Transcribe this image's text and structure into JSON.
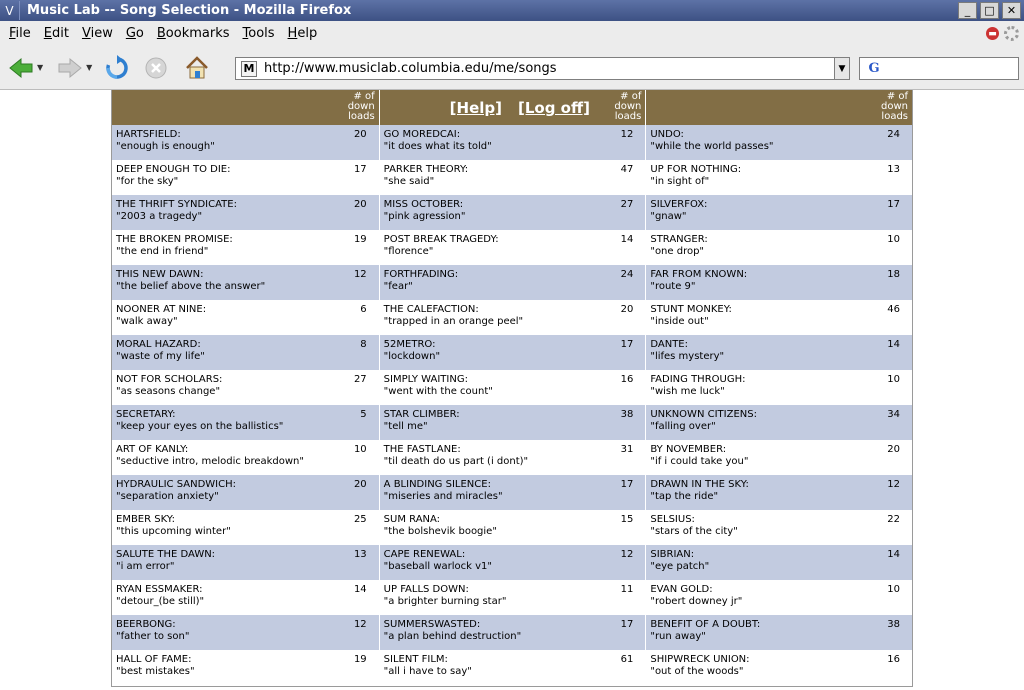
{
  "window": {
    "title": "Music Lab -- Song Selection - Mozilla Firefox",
    "menu_glyph": "V",
    "minimize_glyph": "_",
    "maximize_glyph": "□",
    "close_glyph": "✕"
  },
  "menubar": {
    "items": [
      {
        "key": "F",
        "rest": "ile"
      },
      {
        "key": "E",
        "rest": "dit"
      },
      {
        "key": "V",
        "rest": "iew"
      },
      {
        "key": "G",
        "rest": "o"
      },
      {
        "key": "B",
        "rest": "ookmarks"
      },
      {
        "key": "T",
        "rest": "ools"
      },
      {
        "key": "H",
        "rest": "elp"
      }
    ]
  },
  "toolbar": {
    "url": "http://www.musiclab.columbia.edu/me/songs",
    "favicon_letter": "M",
    "search_engine_letter": "G"
  },
  "icons": {
    "back": "back-arrow-icon",
    "forward": "forward-arrow-icon",
    "reload": "reload-icon",
    "stop": "stop-icon",
    "home": "home-icon",
    "search_engine": "google-icon",
    "throbber": "throbber-icon",
    "stop_red": "stop-red-icon"
  },
  "colors": {
    "header_bg": "#826e45",
    "shade_row": "#c2cbe0",
    "titlebar": "#4a5e94"
  },
  "page": {
    "downloads_label": [
      "# of",
      "down",
      "loads"
    ],
    "help_link": "[Help]",
    "logoff_link": "[Log off]",
    "columns": [
      [
        {
          "band": "HARTSFIELD:",
          "song": "\"enough is enough\"",
          "downloads": 20
        },
        {
          "band": "DEEP ENOUGH TO DIE:",
          "song": "\"for the sky\"",
          "downloads": 17
        },
        {
          "band": "THE THRIFT SYNDICATE:",
          "song": "\"2003 a tragedy\"",
          "downloads": 20
        },
        {
          "band": "THE BROKEN PROMISE:",
          "song": "\"the end in friend\"",
          "downloads": 19
        },
        {
          "band": "THIS NEW DAWN:",
          "song": "\"the belief above the answer\"",
          "downloads": 12
        },
        {
          "band": "NOONER AT NINE:",
          "song": "\"walk away\"",
          "downloads": 6
        },
        {
          "band": "MORAL HAZARD:",
          "song": "\"waste of my life\"",
          "downloads": 8
        },
        {
          "band": "NOT FOR SCHOLARS:",
          "song": "\"as seasons change\"",
          "downloads": 27
        },
        {
          "band": "SECRETARY:",
          "song": "\"keep your eyes on the ballistics\"",
          "downloads": 5
        },
        {
          "band": "ART OF KANLY:",
          "song": "\"seductive intro, melodic breakdown\"",
          "downloads": 10
        },
        {
          "band": "HYDRAULIC SANDWICH:",
          "song": "\"separation anxiety\"",
          "downloads": 20
        },
        {
          "band": "EMBER SKY:",
          "song": "\"this upcoming winter\"",
          "downloads": 25
        },
        {
          "band": "SALUTE THE DAWN:",
          "song": "\"i am error\"",
          "downloads": 13
        },
        {
          "band": "RYAN ESSMAKER:",
          "song": "\"detour_(be still)\"",
          "downloads": 14
        },
        {
          "band": "BEERBONG:",
          "song": "\"father to son\"",
          "downloads": 12
        },
        {
          "band": "HALL OF FAME:",
          "song": "\"best mistakes\"",
          "downloads": 19
        }
      ],
      [
        {
          "band": "GO MOREDCAI:",
          "song": "\"it does what its told\"",
          "downloads": 12
        },
        {
          "band": "PARKER THEORY:",
          "song": "\"she said\"",
          "downloads": 47
        },
        {
          "band": "MISS OCTOBER:",
          "song": "\"pink agression\"",
          "downloads": 27
        },
        {
          "band": "POST BREAK TRAGEDY:",
          "song": "\"florence\"",
          "downloads": 14
        },
        {
          "band": "FORTHFADING:",
          "song": "\"fear\"",
          "downloads": 24
        },
        {
          "band": "THE CALEFACTION:",
          "song": "\"trapped in an orange peel\"",
          "downloads": 20
        },
        {
          "band": "52METRO:",
          "song": "\"lockdown\"",
          "downloads": 17
        },
        {
          "band": "SIMPLY WAITING:",
          "song": "\"went with the count\"",
          "downloads": 16
        },
        {
          "band": "STAR CLIMBER:",
          "song": "\"tell me\"",
          "downloads": 38
        },
        {
          "band": "THE FASTLANE:",
          "song": "\"til death do us part (i dont)\"",
          "downloads": 31
        },
        {
          "band": "A BLINDING SILENCE:",
          "song": "\"miseries and miracles\"",
          "downloads": 17
        },
        {
          "band": "SUM RANA:",
          "song": "\"the bolshevik boogie\"",
          "downloads": 15
        },
        {
          "band": "CAPE RENEWAL:",
          "song": "\"baseball warlock v1\"",
          "downloads": 12
        },
        {
          "band": "UP FALLS DOWN:",
          "song": "\"a brighter burning star\"",
          "downloads": 11
        },
        {
          "band": "SUMMERSWASTED:",
          "song": "\"a plan behind destruction\"",
          "downloads": 17
        },
        {
          "band": "SILENT FILM:",
          "song": "\"all i have to say\"",
          "downloads": 61
        }
      ],
      [
        {
          "band": "UNDO:",
          "song": "\"while the world passes\"",
          "downloads": 24
        },
        {
          "band": "UP FOR NOTHING:",
          "song": "\"in sight of\"",
          "downloads": 13
        },
        {
          "band": "SILVERFOX:",
          "song": "\"gnaw\"",
          "downloads": 17
        },
        {
          "band": "STRANGER:",
          "song": "\"one drop\"",
          "downloads": 10
        },
        {
          "band": "FAR FROM KNOWN:",
          "song": "\"route 9\"",
          "downloads": 18
        },
        {
          "band": "STUNT MONKEY:",
          "song": "\"inside out\"",
          "downloads": 46
        },
        {
          "band": "DANTE:",
          "song": "\"lifes mystery\"",
          "downloads": 14
        },
        {
          "band": "FADING THROUGH:",
          "song": "\"wish me luck\"",
          "downloads": 10
        },
        {
          "band": "UNKNOWN CITIZENS:",
          "song": "\"falling over\"",
          "downloads": 34
        },
        {
          "band": "BY NOVEMBER:",
          "song": "\"if i could take you\"",
          "downloads": 20
        },
        {
          "band": "DRAWN IN THE SKY:",
          "song": "\"tap the ride\"",
          "downloads": 12
        },
        {
          "band": "SELSIUS:",
          "song": "\"stars of the city\"",
          "downloads": 22
        },
        {
          "band": "SIBRIAN:",
          "song": "\"eye patch\"",
          "downloads": 14
        },
        {
          "band": "EVAN GOLD:",
          "song": "\"robert downey jr\"",
          "downloads": 10
        },
        {
          "band": "BENEFIT OF A DOUBT:",
          "song": "\"run away\"",
          "downloads": 38
        },
        {
          "band": "SHIPWRECK UNION:",
          "song": "\"out of the woods\"",
          "downloads": 16
        }
      ]
    ]
  }
}
